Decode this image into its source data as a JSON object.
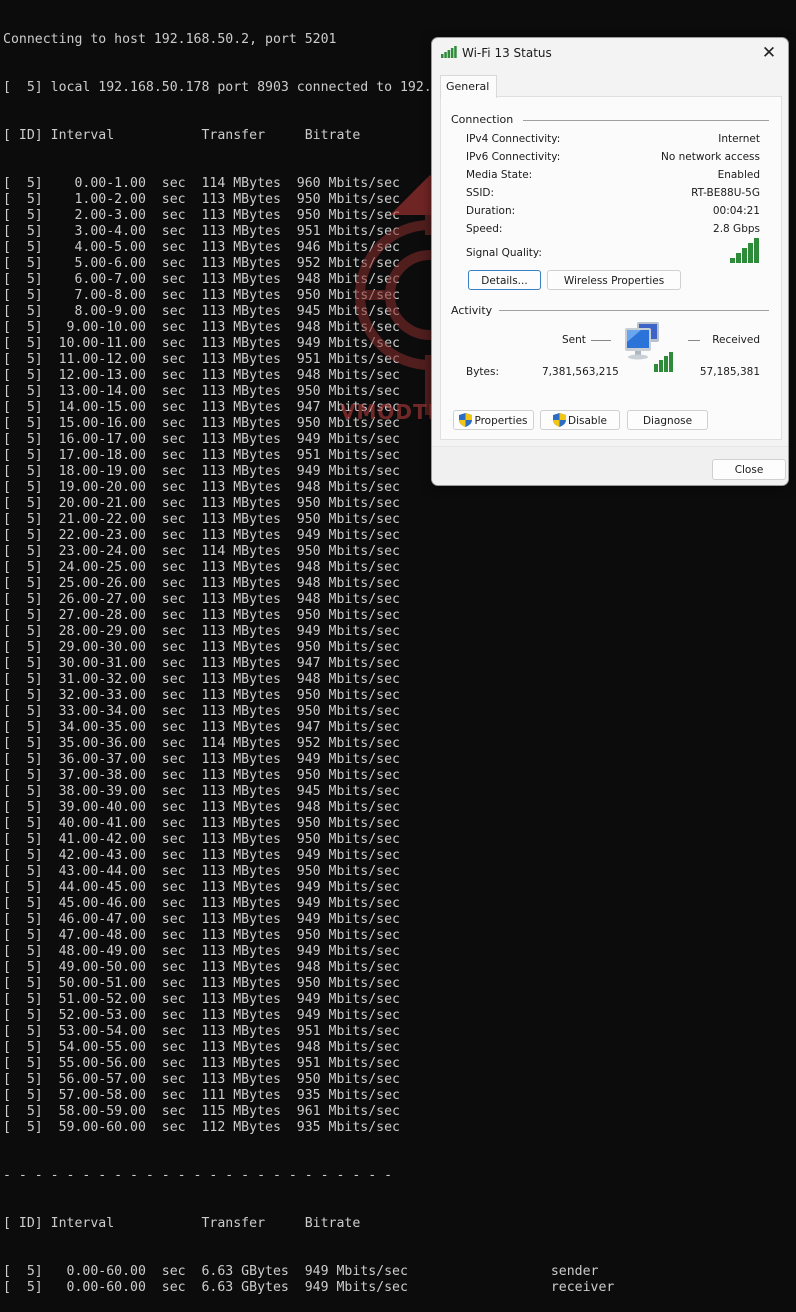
{
  "terminal": {
    "connecting_line": "Connecting to host 192.168.50.2, port 5201",
    "local_line": "[  5] local 192.168.50.178 port 8903 connected to 192.168.50.2 port 5201",
    "header_line": "[ ID] Interval           Transfer     Bitrate",
    "separator_line": "- - - - - - - - - - - - - - - - - - - - - - - - -",
    "interval_rows": [
      {
        "id": "5",
        "interval": "0.00-1.00",
        "transfer": "114 MBytes",
        "bitrate": "960 Mbits/sec"
      },
      {
        "id": "5",
        "interval": "1.00-2.00",
        "transfer": "113 MBytes",
        "bitrate": "950 Mbits/sec"
      },
      {
        "id": "5",
        "interval": "2.00-3.00",
        "transfer": "113 MBytes",
        "bitrate": "950 Mbits/sec"
      },
      {
        "id": "5",
        "interval": "3.00-4.00",
        "transfer": "113 MBytes",
        "bitrate": "951 Mbits/sec"
      },
      {
        "id": "5",
        "interval": "4.00-5.00",
        "transfer": "113 MBytes",
        "bitrate": "946 Mbits/sec"
      },
      {
        "id": "5",
        "interval": "5.00-6.00",
        "transfer": "113 MBytes",
        "bitrate": "952 Mbits/sec"
      },
      {
        "id": "5",
        "interval": "6.00-7.00",
        "transfer": "113 MBytes",
        "bitrate": "948 Mbits/sec"
      },
      {
        "id": "5",
        "interval": "7.00-8.00",
        "transfer": "113 MBytes",
        "bitrate": "950 Mbits/sec"
      },
      {
        "id": "5",
        "interval": "8.00-9.00",
        "transfer": "113 MBytes",
        "bitrate": "945 Mbits/sec"
      },
      {
        "id": "5",
        "interval": "9.00-10.00",
        "transfer": "113 MBytes",
        "bitrate": "948 Mbits/sec"
      },
      {
        "id": "5",
        "interval": "10.00-11.00",
        "transfer": "113 MBytes",
        "bitrate": "949 Mbits/sec"
      },
      {
        "id": "5",
        "interval": "11.00-12.00",
        "transfer": "113 MBytes",
        "bitrate": "951 Mbits/sec"
      },
      {
        "id": "5",
        "interval": "12.00-13.00",
        "transfer": "113 MBytes",
        "bitrate": "948 Mbits/sec"
      },
      {
        "id": "5",
        "interval": "13.00-14.00",
        "transfer": "113 MBytes",
        "bitrate": "950 Mbits/sec"
      },
      {
        "id": "5",
        "interval": "14.00-15.00",
        "transfer": "113 MBytes",
        "bitrate": "947 Mbits/sec"
      },
      {
        "id": "5",
        "interval": "15.00-16.00",
        "transfer": "113 MBytes",
        "bitrate": "950 Mbits/sec"
      },
      {
        "id": "5",
        "interval": "16.00-17.00",
        "transfer": "113 MBytes",
        "bitrate": "949 Mbits/sec"
      },
      {
        "id": "5",
        "interval": "17.00-18.00",
        "transfer": "113 MBytes",
        "bitrate": "951 Mbits/sec"
      },
      {
        "id": "5",
        "interval": "18.00-19.00",
        "transfer": "113 MBytes",
        "bitrate": "949 Mbits/sec"
      },
      {
        "id": "5",
        "interval": "19.00-20.00",
        "transfer": "113 MBytes",
        "bitrate": "948 Mbits/sec"
      },
      {
        "id": "5",
        "interval": "20.00-21.00",
        "transfer": "113 MBytes",
        "bitrate": "950 Mbits/sec"
      },
      {
        "id": "5",
        "interval": "21.00-22.00",
        "transfer": "113 MBytes",
        "bitrate": "950 Mbits/sec"
      },
      {
        "id": "5",
        "interval": "22.00-23.00",
        "transfer": "113 MBytes",
        "bitrate": "949 Mbits/sec"
      },
      {
        "id": "5",
        "interval": "23.00-24.00",
        "transfer": "114 MBytes",
        "bitrate": "950 Mbits/sec"
      },
      {
        "id": "5",
        "interval": "24.00-25.00",
        "transfer": "113 MBytes",
        "bitrate": "948 Mbits/sec"
      },
      {
        "id": "5",
        "interval": "25.00-26.00",
        "transfer": "113 MBytes",
        "bitrate": "948 Mbits/sec"
      },
      {
        "id": "5",
        "interval": "26.00-27.00",
        "transfer": "113 MBytes",
        "bitrate": "948 Mbits/sec"
      },
      {
        "id": "5",
        "interval": "27.00-28.00",
        "transfer": "113 MBytes",
        "bitrate": "950 Mbits/sec"
      },
      {
        "id": "5",
        "interval": "28.00-29.00",
        "transfer": "113 MBytes",
        "bitrate": "949 Mbits/sec"
      },
      {
        "id": "5",
        "interval": "29.00-30.00",
        "transfer": "113 MBytes",
        "bitrate": "950 Mbits/sec"
      },
      {
        "id": "5",
        "interval": "30.00-31.00",
        "transfer": "113 MBytes",
        "bitrate": "947 Mbits/sec"
      },
      {
        "id": "5",
        "interval": "31.00-32.00",
        "transfer": "113 MBytes",
        "bitrate": "948 Mbits/sec"
      },
      {
        "id": "5",
        "interval": "32.00-33.00",
        "transfer": "113 MBytes",
        "bitrate": "950 Mbits/sec"
      },
      {
        "id": "5",
        "interval": "33.00-34.00",
        "transfer": "113 MBytes",
        "bitrate": "950 Mbits/sec"
      },
      {
        "id": "5",
        "interval": "34.00-35.00",
        "transfer": "113 MBytes",
        "bitrate": "947 Mbits/sec"
      },
      {
        "id": "5",
        "interval": "35.00-36.00",
        "transfer": "114 MBytes",
        "bitrate": "952 Mbits/sec"
      },
      {
        "id": "5",
        "interval": "36.00-37.00",
        "transfer": "113 MBytes",
        "bitrate": "949 Mbits/sec"
      },
      {
        "id": "5",
        "interval": "37.00-38.00",
        "transfer": "113 MBytes",
        "bitrate": "950 Mbits/sec"
      },
      {
        "id": "5",
        "interval": "38.00-39.00",
        "transfer": "113 MBytes",
        "bitrate": "945 Mbits/sec"
      },
      {
        "id": "5",
        "interval": "39.00-40.00",
        "transfer": "113 MBytes",
        "bitrate": "948 Mbits/sec"
      },
      {
        "id": "5",
        "interval": "40.00-41.00",
        "transfer": "113 MBytes",
        "bitrate": "950 Mbits/sec"
      },
      {
        "id": "5",
        "interval": "41.00-42.00",
        "transfer": "113 MBytes",
        "bitrate": "950 Mbits/sec"
      },
      {
        "id": "5",
        "interval": "42.00-43.00",
        "transfer": "113 MBytes",
        "bitrate": "949 Mbits/sec"
      },
      {
        "id": "5",
        "interval": "43.00-44.00",
        "transfer": "113 MBytes",
        "bitrate": "950 Mbits/sec"
      },
      {
        "id": "5",
        "interval": "44.00-45.00",
        "transfer": "113 MBytes",
        "bitrate": "949 Mbits/sec"
      },
      {
        "id": "5",
        "interval": "45.00-46.00",
        "transfer": "113 MBytes",
        "bitrate": "949 Mbits/sec"
      },
      {
        "id": "5",
        "interval": "46.00-47.00",
        "transfer": "113 MBytes",
        "bitrate": "949 Mbits/sec"
      },
      {
        "id": "5",
        "interval": "47.00-48.00",
        "transfer": "113 MBytes",
        "bitrate": "950 Mbits/sec"
      },
      {
        "id": "5",
        "interval": "48.00-49.00",
        "transfer": "113 MBytes",
        "bitrate": "949 Mbits/sec"
      },
      {
        "id": "5",
        "interval": "49.00-50.00",
        "transfer": "113 MBytes",
        "bitrate": "948 Mbits/sec"
      },
      {
        "id": "5",
        "interval": "50.00-51.00",
        "transfer": "113 MBytes",
        "bitrate": "950 Mbits/sec"
      },
      {
        "id": "5",
        "interval": "51.00-52.00",
        "transfer": "113 MBytes",
        "bitrate": "949 Mbits/sec"
      },
      {
        "id": "5",
        "interval": "52.00-53.00",
        "transfer": "113 MBytes",
        "bitrate": "949 Mbits/sec"
      },
      {
        "id": "5",
        "interval": "53.00-54.00",
        "transfer": "113 MBytes",
        "bitrate": "951 Mbits/sec"
      },
      {
        "id": "5",
        "interval": "54.00-55.00",
        "transfer": "113 MBytes",
        "bitrate": "948 Mbits/sec"
      },
      {
        "id": "5",
        "interval": "55.00-56.00",
        "transfer": "113 MBytes",
        "bitrate": "951 Mbits/sec"
      },
      {
        "id": "5",
        "interval": "56.00-57.00",
        "transfer": "113 MBytes",
        "bitrate": "950 Mbits/sec"
      },
      {
        "id": "5",
        "interval": "57.00-58.00",
        "transfer": "111 MBytes",
        "bitrate": "935 Mbits/sec"
      },
      {
        "id": "5",
        "interval": "58.00-59.00",
        "transfer": "115 MBytes",
        "bitrate": "961 Mbits/sec"
      },
      {
        "id": "5",
        "interval": "59.00-60.00",
        "transfer": "112 MBytes",
        "bitrate": "935 Mbits/sec"
      }
    ],
    "unit_sec": "sec",
    "summary_rows": [
      {
        "id": "5",
        "interval": "0.00-60.00",
        "transfer": "6.63 GBytes",
        "bitrate": "949 Mbits/sec",
        "role": "sender"
      },
      {
        "id": "5",
        "interval": "0.00-60.00",
        "transfer": "6.63 GBytes",
        "bitrate": "949 Mbits/sec",
        "role": "receiver"
      }
    ]
  },
  "watermark": {
    "text": "VMODTECH.COM",
    "color": "#b33a3a"
  },
  "dialog": {
    "title": "Wi-Fi 13 Status",
    "close_glyph": "✕",
    "tab": "General",
    "connection": {
      "group_label": "Connection",
      "rows": [
        {
          "label": "IPv4 Connectivity:",
          "value": "Internet"
        },
        {
          "label": "IPv6 Connectivity:",
          "value": "No network access"
        },
        {
          "label": "Media State:",
          "value": "Enabled"
        },
        {
          "label": "SSID:",
          "value": "RT-BE88U-5G"
        },
        {
          "label": "Duration:",
          "value": "00:04:21"
        },
        {
          "label": "Speed:",
          "value": "2.8 Gbps"
        }
      ],
      "signal_label": "Signal Quality:",
      "signal_bars": 5,
      "signal_bars_max": 5,
      "details_button": "Details...",
      "wireless_properties_button": "Wireless Properties"
    },
    "activity": {
      "group_label": "Activity",
      "sent_label": "Sent",
      "received_label": "Received",
      "bytes_label": "Bytes:",
      "bytes_sent": "7,381,563,215",
      "bytes_received": "57,185,381",
      "properties_button": "Properties",
      "disable_button": "Disable",
      "diagnose_button": "Diagnose"
    },
    "close_button": "Close",
    "colors": {
      "signal_green": "#2e8b3a",
      "focus_blue": "#3a7fc1",
      "shield_blue": "#2b6cc4",
      "shield_yellow": "#f3c613"
    }
  }
}
